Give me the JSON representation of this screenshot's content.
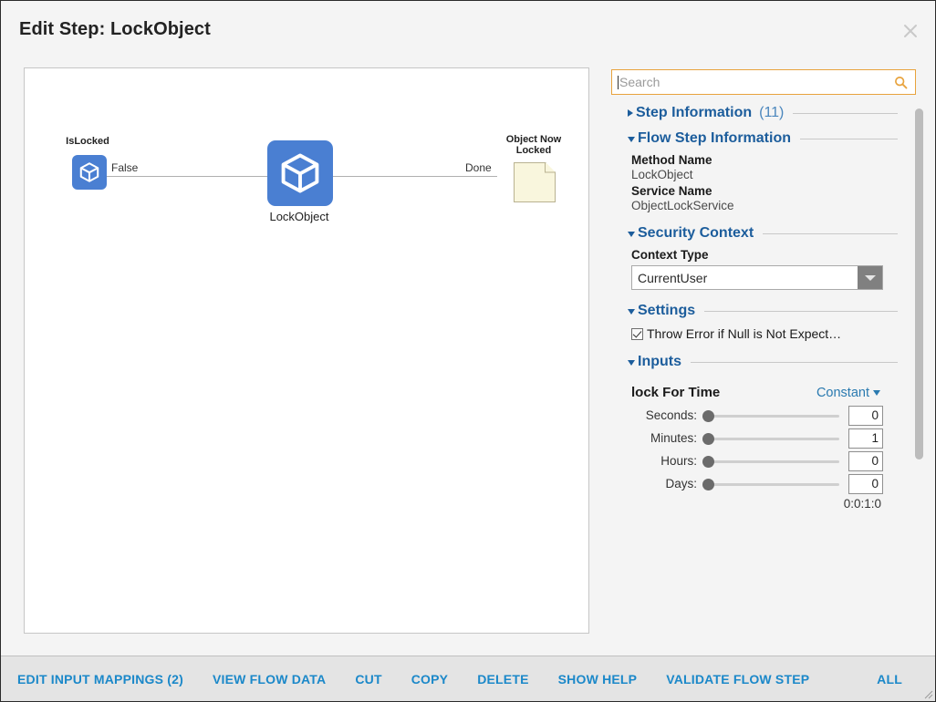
{
  "dialog": {
    "title": "Edit Step: LockObject",
    "close_icon": "close-icon"
  },
  "canvas": {
    "nodes": [
      {
        "id": "islocked",
        "label": "IsLocked",
        "icon": "cube-icon",
        "sublabel": ""
      },
      {
        "id": "lockobject",
        "label": "",
        "icon": "cube-icon",
        "sublabel": "LockObject"
      },
      {
        "id": "objectnowlocked",
        "label": "Object Now\nLocked",
        "icon": "note-icon",
        "sublabel": ""
      }
    ],
    "edges": [
      {
        "from": "islocked",
        "to": "lockobject",
        "label": "False"
      },
      {
        "from": "lockobject",
        "to": "objectnowlocked",
        "label": "Done"
      }
    ]
  },
  "search": {
    "placeholder": "Search",
    "value": "",
    "icon": "search-icon"
  },
  "panel": {
    "sections": [
      {
        "key": "step_information",
        "title": "Step Information",
        "count": "(11)",
        "expanded": false
      },
      {
        "key": "flow_step_information",
        "title": "Flow Step Information",
        "count": "",
        "expanded": true
      },
      {
        "key": "security_context",
        "title": "Security Context",
        "count": "",
        "expanded": true
      },
      {
        "key": "settings",
        "title": "Settings",
        "count": "",
        "expanded": true
      },
      {
        "key": "inputs",
        "title": "Inputs",
        "count": "",
        "expanded": true
      }
    ],
    "flow_step_information": {
      "method_name_label": "Method Name",
      "method_name_value": "LockObject",
      "service_name_label": "Service Name",
      "service_name_value": "ObjectLockService"
    },
    "security_context": {
      "context_type_label": "Context Type",
      "context_type_value": "CurrentUser"
    },
    "settings": {
      "throw_error_label": "Throw Error if Null is Not Expect…",
      "throw_error_checked": true
    },
    "inputs": {
      "name": "lock For Time",
      "mode": "Constant",
      "sliders": [
        {
          "label": "Seconds:",
          "value": "0",
          "percent": 0
        },
        {
          "label": "Minutes:",
          "value": "1",
          "percent": 0
        },
        {
          "label": "Hours:",
          "value": "0",
          "percent": 0
        },
        {
          "label": "Days:",
          "value": "0",
          "percent": 0
        }
      ],
      "summary": "0:0:1:0"
    }
  },
  "toolbar": {
    "buttons": [
      {
        "key": "edit_input_mappings",
        "label": "EDIT INPUT MAPPINGS (2)"
      },
      {
        "key": "view_flow_data",
        "label": "VIEW FLOW DATA"
      },
      {
        "key": "cut",
        "label": "CUT"
      },
      {
        "key": "copy",
        "label": "COPY"
      },
      {
        "key": "delete",
        "label": "DELETE"
      },
      {
        "key": "show_help",
        "label": "SHOW HELP"
      },
      {
        "key": "validate_flow_step",
        "label": "VALIDATE FLOW STEP"
      },
      {
        "key": "all",
        "label": "ALL"
      }
    ]
  },
  "colors": {
    "accent_blue": "#1b88c9",
    "section_blue": "#1c5d9c",
    "node_blue": "#4a7fd2",
    "search_border": "#e8a33d",
    "note_cream": "#f9f6dd"
  }
}
